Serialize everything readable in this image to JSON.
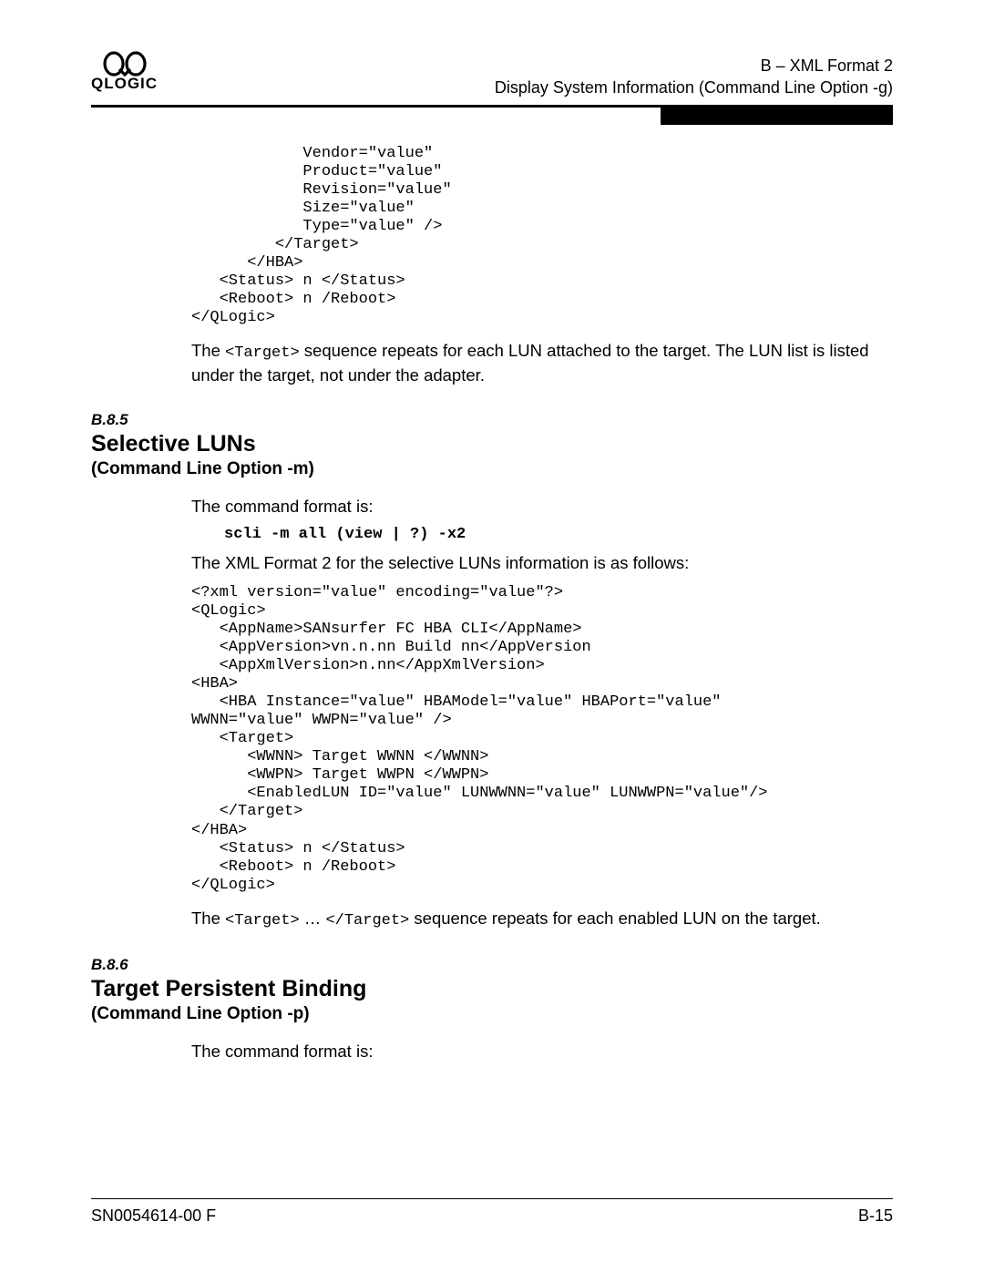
{
  "header": {
    "logo_glyph": "ↂↂ",
    "logo_text": "QLOGIC",
    "line1": "B – XML Format 2",
    "line2": "Display System Information (Command Line Option -g)"
  },
  "code1": "            Vendor=\"value\"\n            Product=\"value\"\n            Revision=\"value\"\n            Size=\"value\"\n            Type=\"value\" />\n         </Target>\n      </HBA>\n   <Status> n </Status>\n   <Reboot> n /Reboot>\n</QLogic>",
  "para1_pre": "The ",
  "para1_code": "<Target>",
  "para1_post": " sequence repeats for each LUN attached to the target. The LUN list is listed under the target, not under the adapter.",
  "sec85_num": "B.8.5",
  "sec85_title": "Selective LUNs",
  "sec85_sub": "(Command Line Option -m)",
  "cmd_intro": "The command format is:",
  "cmd85": "scli -m all (view | ?) -x2",
  "xml_intro_85": "The XML Format 2 for the selective LUNs information is as follows:",
  "code2": "<?xml version=\"value\" encoding=\"value\"?>\n<QLogic>\n   <AppName>SANsurfer FC HBA CLI</AppName>\n   <AppVersion>vn.n.nn Build nn</AppVersion\n   <AppXmlVersion>n.nn</AppXmlVersion>\n<HBA>\n   <HBA Instance=\"value\" HBAModel=\"value\" HBAPort=\"value\" \nWWNN=\"value\" WWPN=\"value\" />\n   <Target>\n      <WWNN> Target WWNN </WWNN>\n      <WWPN> Target WWPN </WWPN>\n      <EnabledLUN ID=\"value\" LUNWWNN=\"value\" LUNWWPN=\"value\"/>\n   </Target>\n</HBA>\n   <Status> n </Status>\n   <Reboot> n /Reboot>\n</QLogic>",
  "para2_pre": "The ",
  "para2_code1": "<Target>",
  "para2_mid": " … ",
  "para2_code2": "</Target>",
  "para2_post": "  sequence repeats for each enabled LUN on the target.",
  "sec86_num": "B.8.6",
  "sec86_title": "Target Persistent Binding",
  "sec86_sub": "(Command Line Option -p)",
  "footer": {
    "left": "SN0054614-00  F",
    "right": "B-15"
  }
}
